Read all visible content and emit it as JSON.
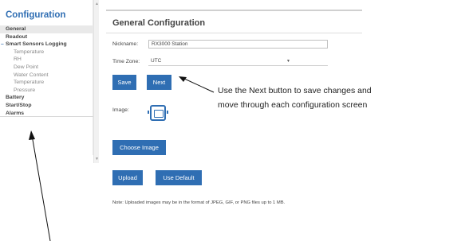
{
  "sidebar": {
    "title": "Configuration",
    "items": [
      {
        "label": "General",
        "level": "top",
        "selected": true
      },
      {
        "label": "Readout",
        "level": "top"
      },
      {
        "label": "Smart Sensors Logging",
        "level": "top",
        "expanded": true
      },
      {
        "label": "Temperature",
        "level": "sub"
      },
      {
        "label": "RH",
        "level": "sub"
      },
      {
        "label": "Dew Point",
        "level": "sub"
      },
      {
        "label": "Water Content",
        "level": "sub"
      },
      {
        "label": "Temperature",
        "level": "sub"
      },
      {
        "label": "Pressure",
        "level": "sub"
      },
      {
        "label": "Battery",
        "level": "top"
      },
      {
        "label": "Start/Stop",
        "level": "top"
      },
      {
        "label": "Alarms",
        "level": "top"
      }
    ]
  },
  "panel": {
    "title": "General Configuration",
    "nickname_label": "Nickname:",
    "nickname_value": "RX3000 Station",
    "timezone_label": "Time Zone:",
    "timezone_value": "UTC",
    "save_label": "Save",
    "next_label": "Next",
    "image_label": "Image:",
    "choose_image_label": "Choose Image",
    "upload_label": "Upload",
    "use_default_label": "Use Default",
    "note": "Note: Uploaded images may be in the format of JPEG, GIF, or PNG files up to 1 MB."
  },
  "annotation": {
    "line1": "Use the Next button to save changes and",
    "line2": "move through each configuration screen"
  },
  "colors": {
    "accent": "#2f6eb3",
    "selected_bg": "#e9e9e9"
  }
}
